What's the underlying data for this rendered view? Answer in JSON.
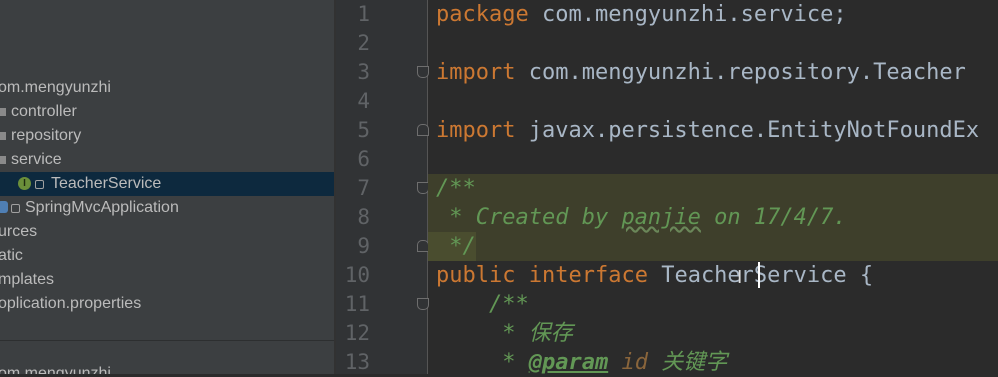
{
  "project_tree": {
    "items": [
      {
        "label": "om.mengyunzhi",
        "kind": "package"
      },
      {
        "label": "controller",
        "kind": "package"
      },
      {
        "label": "repository",
        "kind": "package"
      },
      {
        "label": "service",
        "kind": "package"
      },
      {
        "label": "TeacherService",
        "kind": "interface",
        "selected": true
      },
      {
        "label": "SpringMvcApplication",
        "kind": "class"
      },
      {
        "label": "urces",
        "kind": "folder"
      },
      {
        "label": "atic",
        "kind": "folder"
      },
      {
        "label": "mplates",
        "kind": "folder"
      },
      {
        "label": "oplication.properties",
        "kind": "file"
      }
    ],
    "bottom_partial": "om.mengyunzhi"
  },
  "editor": {
    "line_numbers": [
      "1",
      "2",
      "3",
      "4",
      "5",
      "6",
      "7",
      "8",
      "9",
      "10",
      "11",
      "12",
      "13"
    ],
    "lines": {
      "l1_kw": "package",
      "l1_rest": " com.mengyunzhi.service;",
      "l3_kw": "import",
      "l3_rest": " com.mengyunzhi.repository.Teacher",
      "l5_kw": "import",
      "l5_rest": " javax.persistence.EntityNotFoundEx",
      "l7": "/**",
      "l8_a": " * Created by ",
      "l8_b": "panjie",
      "l8_c": " on 17/4/7.",
      "l9": " */",
      "l10_kw1": "public",
      "l10_kw2": "interface",
      "l10_name": "TeacherService",
      "l10_brace": " {",
      "l11": "    /**",
      "l12": "     * 保存",
      "l13_a": "     * ",
      "l13_tag": "@param",
      "l13_param": " id",
      "l13_text": " 关键字"
    }
  },
  "colors": {
    "keyword": "#cc7832",
    "doc_comment": "#629755",
    "text": "#a9b7c6",
    "selection": "#0d293e"
  }
}
